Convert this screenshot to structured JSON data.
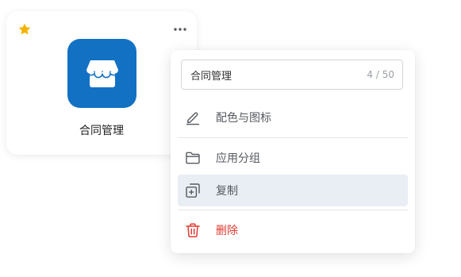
{
  "app_card": {
    "name": "合同管理",
    "favorited": true,
    "icon": "storefront-icon",
    "icon_bg_color": "#1371c4",
    "star_color": "#f5b301"
  },
  "context_menu": {
    "name_input": {
      "value": "合同管理",
      "char_count": "4 / 50"
    },
    "items": [
      {
        "label": "配色与图标",
        "icon": "edit-pen-icon"
      },
      {
        "label": "应用分组",
        "icon": "folder-icon"
      },
      {
        "label": "复制",
        "icon": "copy-icon",
        "highlighted": true
      },
      {
        "label": "删除",
        "icon": "trash-icon",
        "danger": true
      }
    ],
    "danger_color": "#e0382f"
  }
}
